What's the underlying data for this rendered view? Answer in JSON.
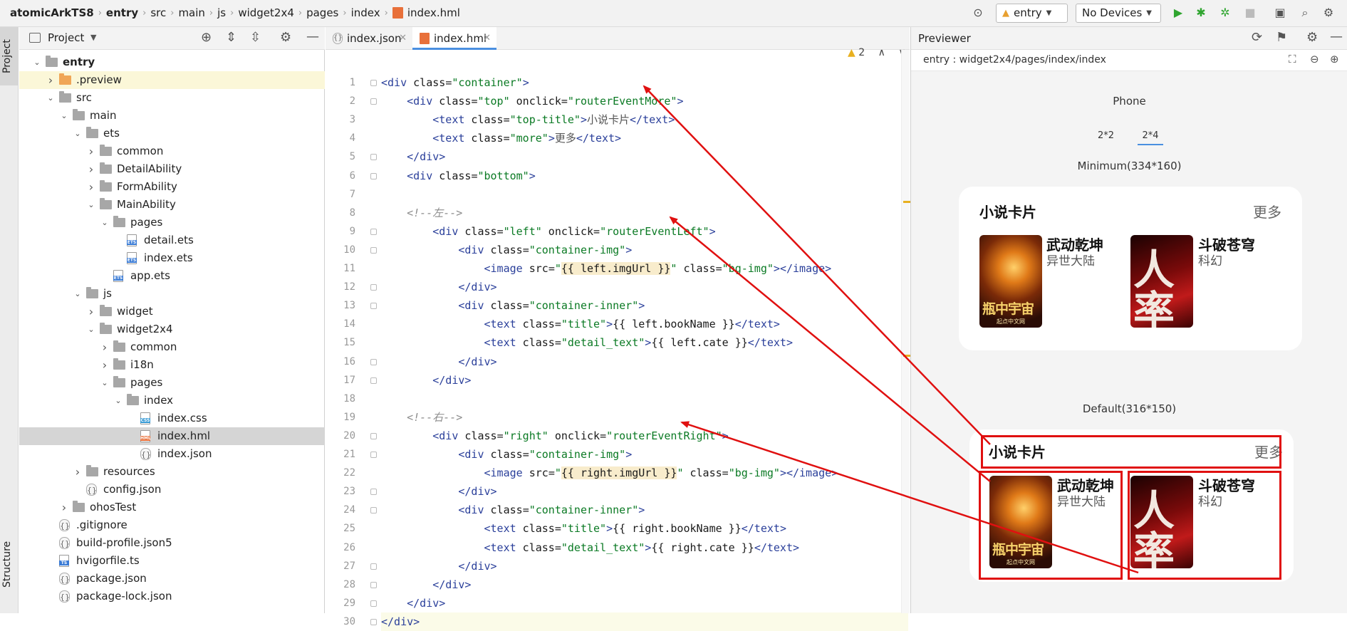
{
  "topbar": {
    "breadcrumbs": [
      "atomicArkTS8",
      "entry",
      "src",
      "main",
      "js",
      "widget2x4",
      "pages",
      "index",
      "index.hml"
    ],
    "module_select": "entry",
    "device_select": "No Devices"
  },
  "left_strip": {
    "project_tab": "Project",
    "structure_tab": "Structure"
  },
  "project_panel": {
    "title": "Project",
    "tree": [
      {
        "label": "entry",
        "kind": "folder",
        "depth": 1,
        "expanded": true,
        "bold": true
      },
      {
        "label": ".preview",
        "kind": "folder-orange",
        "depth": 2,
        "expanded": false
      },
      {
        "label": "src",
        "kind": "folder",
        "depth": 2,
        "expanded": true
      },
      {
        "label": "main",
        "kind": "folder",
        "depth": 3,
        "expanded": true
      },
      {
        "label": "ets",
        "kind": "folder",
        "depth": 4,
        "expanded": true
      },
      {
        "label": "common",
        "kind": "folder",
        "depth": 5,
        "expanded": false
      },
      {
        "label": "DetailAbility",
        "kind": "folder",
        "depth": 5,
        "expanded": false
      },
      {
        "label": "FormAbility",
        "kind": "folder",
        "depth": 5,
        "expanded": false
      },
      {
        "label": "MainAbility",
        "kind": "folder",
        "depth": 5,
        "expanded": true
      },
      {
        "label": "pages",
        "kind": "folder",
        "depth": 6,
        "expanded": true
      },
      {
        "label": "detail.ets",
        "kind": "ets",
        "depth": 7
      },
      {
        "label": "index.ets",
        "kind": "ets",
        "depth": 7
      },
      {
        "label": "app.ets",
        "kind": "ets",
        "depth": 6
      },
      {
        "label": "js",
        "kind": "folder",
        "depth": 4,
        "expanded": true
      },
      {
        "label": "widget",
        "kind": "folder",
        "depth": 5,
        "expanded": false
      },
      {
        "label": "widget2x4",
        "kind": "folder",
        "depth": 5,
        "expanded": true
      },
      {
        "label": "common",
        "kind": "folder",
        "depth": 6,
        "expanded": false
      },
      {
        "label": "i18n",
        "kind": "folder",
        "depth": 6,
        "expanded": false
      },
      {
        "label": "pages",
        "kind": "folder",
        "depth": 6,
        "expanded": true
      },
      {
        "label": "index",
        "kind": "folder",
        "depth": 7,
        "expanded": true
      },
      {
        "label": "index.css",
        "kind": "css",
        "depth": 8
      },
      {
        "label": "index.hml",
        "kind": "hml",
        "depth": 8,
        "selected": true
      },
      {
        "label": "index.json",
        "kind": "json",
        "depth": 8
      },
      {
        "label": "resources",
        "kind": "folder",
        "depth": 4,
        "expanded": false
      },
      {
        "label": "config.json",
        "kind": "json",
        "depth": 4
      },
      {
        "label": "ohosTest",
        "kind": "folder",
        "depth": 3,
        "expanded": false
      },
      {
        "label": ".gitignore",
        "kind": "json",
        "depth": 2
      },
      {
        "label": "build-profile.json5",
        "kind": "json",
        "depth": 2
      },
      {
        "label": "hvigorfile.ts",
        "kind": "ts",
        "depth": 2
      },
      {
        "label": "package.json",
        "kind": "json",
        "depth": 2
      },
      {
        "label": "package-lock.json",
        "kind": "json",
        "depth": 2
      }
    ]
  },
  "editor": {
    "tabs": [
      {
        "label": "index.json",
        "active": false
      },
      {
        "label": "index.hml",
        "active": true
      }
    ],
    "warning_count": "2",
    "lines": [
      "<div class=\"container\">",
      "    <div class=\"top\" onclick=\"routerEventMore\">",
      "        <text class=\"top-title\">小说卡片</text>",
      "        <text class=\"more\">更多</text>",
      "    </div>",
      "    <div class=\"bottom\">",
      "",
      "    <!--左-->",
      "        <div class=\"left\" onclick=\"routerEventLeft\">",
      "            <div class=\"container-img\">",
      "                <image src=\"{{ left.imgUrl }}\" class=\"bg-img\"></image>",
      "            </div>",
      "            <div class=\"container-inner\">",
      "                <text class=\"title\">{{ left.bookName }}</text>",
      "                <text class=\"detail_text\">{{ left.cate }}</text>",
      "            </div>",
      "        </div>",
      "",
      "    <!--右-->",
      "        <div class=\"right\" onclick=\"routerEventRight\">",
      "            <div class=\"container-img\">",
      "                <image src=\"{{ right.imgUrl }}\" class=\"bg-img\"></image>",
      "            </div>",
      "            <div class=\"container-inner\">",
      "                <text class=\"title\">{{ right.bookName }}</text>",
      "                <text class=\"detail_text\">{{ right.cate }}</text>",
      "            </div>",
      "        </div>",
      "    </div>",
      "</div>"
    ]
  },
  "previewer": {
    "title": "Previewer",
    "path": "entry : widget2x4/pages/index/index",
    "device": "Phone",
    "size_tabs": [
      {
        "label": "2*2",
        "active": false
      },
      {
        "label": "2*4",
        "active": true
      }
    ],
    "sections": [
      {
        "caption": "Minimum(334*160)",
        "card_title": "小说卡片",
        "more": "更多",
        "books": [
          {
            "name": "武动乾坤",
            "cate": "异世大陆",
            "cover_text": "瓶中宇宙",
            "cover_sub": "起点中文网"
          },
          {
            "name": "斗破苍穹",
            "cate": "科幻",
            "cover_text": "人率",
            "cover_sub": ""
          }
        ]
      },
      {
        "caption": "Default(316*150)",
        "card_title": "小说卡片",
        "more": "更多",
        "books": [
          {
            "name": "武动乾坤",
            "cate": "异世大陆",
            "cover_text": "瓶中宇宙",
            "cover_sub": "起点中文网"
          },
          {
            "name": "斗破苍穹",
            "cate": "科幻",
            "cover_text": "人率",
            "cover_sub": ""
          }
        ]
      }
    ]
  },
  "colors": {
    "annotation_red": "#e01010",
    "tab_underline": "#4a8fe0",
    "run_green": "#2fa52f"
  }
}
